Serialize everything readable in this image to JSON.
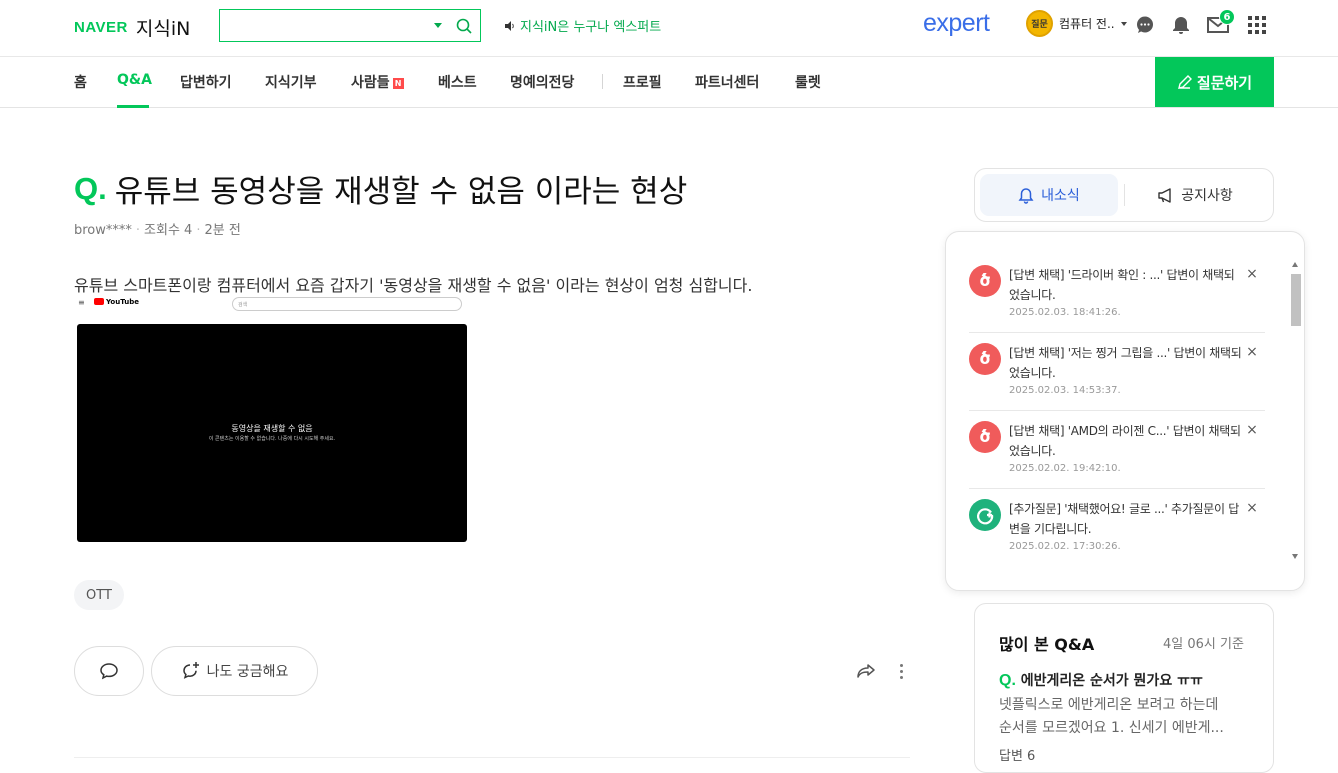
{
  "header": {
    "brand": "NAVER",
    "service": "지식iN",
    "search_placeholder": "",
    "promo_text": "지식iN은 누구나 엑스퍼트",
    "expert_logo": "expert",
    "profile_badge": "질문",
    "profile_name": "컴퓨터 전..",
    "mail_count": "6"
  },
  "nav": {
    "items": [
      "홈",
      "Q&A",
      "답변하기",
      "지식기부",
      "사람들",
      "베스트",
      "명예의전당",
      "프로필",
      "파트너센터",
      "룰렛"
    ],
    "new_badge": "N",
    "ask_button": "질문하기"
  },
  "question": {
    "q_mark": "Q.",
    "title": "유튜브 동영상을 재생할 수 없음 이라는 현상",
    "author": "brow****",
    "views": "조회수 4",
    "time": "2분 전",
    "body": "유튜브 스마트폰이랑 컴퓨터에서 요즘 갑자기 '동영상을 재생할 수 없음' 이라는 현상이 엄청 심합니다.",
    "screenshot": {
      "yt_label": "YouTube",
      "search_text": "검색",
      "error_title": "동영상을 재생할 수 없음",
      "error_sub": "이 콘텐츠는 이용할 수 없습니다. 나중에 다시 시도해 주세요."
    },
    "tag": "OTT",
    "curious_button": "나도 궁금해요"
  },
  "side_tabs": {
    "my_news": "내소식",
    "notice": "공지사항"
  },
  "notifications": [
    {
      "icon": "adopt",
      "text": "[답변 채택] '드라이버 확인 : ...' 답변이 채택되었습니다.",
      "date": "2025.02.03. 18:41:26."
    },
    {
      "icon": "adopt",
      "text": "[답변 채택] '저는 찡거 그립을 ...' 답변이 채택되었습니다.",
      "date": "2025.02.03. 14:53:37."
    },
    {
      "icon": "adopt",
      "text": "[답변 채택] 'AMD의 라이젠 C...' 답변이 채택되었습니다.",
      "date": "2025.02.02. 19:42:10."
    },
    {
      "icon": "followup",
      "text": "[추가질문] '채택했어요! 글로 ...' 추가질문이 답변을 기다립니다.",
      "date": "2025.02.02. 17:30:26."
    }
  ],
  "popular": {
    "title": "많이 본 Q&A",
    "ref_time": "4일 06시 기준",
    "q_mark": "Q.",
    "question": "에반게리온 순서가 뭔가요 ㅠㅠ",
    "desc_line1": "넷플릭스로 에반게리온 보려고 하는데",
    "desc_line2": "순서를 모르겠어요 1. 신세기 에반게...",
    "answers": "답변 6"
  },
  "colors": {
    "brand_green": "#03c75a",
    "expert_blue": "#3a6ee8",
    "adopt_red": "#f05b5b",
    "followup_green": "#1fb27c"
  }
}
